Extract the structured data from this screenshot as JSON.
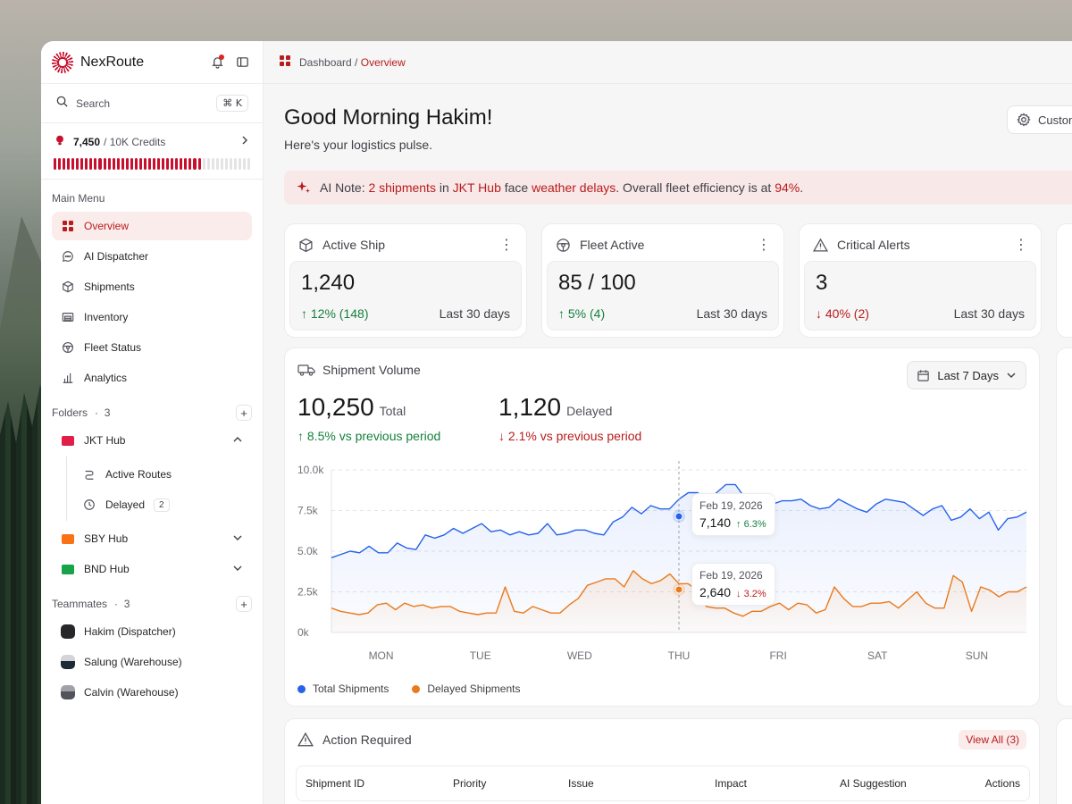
{
  "app": {
    "name": "NexRoute"
  },
  "search": {
    "label": "Search",
    "shortcut": "⌘ K"
  },
  "credits": {
    "used": "7,450",
    "total": "/ 10K Credits",
    "fraction": 0.745
  },
  "menu": {
    "title": "Main Menu",
    "items": [
      {
        "label": "Overview",
        "icon": "grid-icon"
      },
      {
        "label": "AI Dispatcher",
        "icon": "chat-icon"
      },
      {
        "label": "Shipments",
        "icon": "box-icon"
      },
      {
        "label": "Inventory",
        "icon": "warehouse-icon"
      },
      {
        "label": "Fleet Status",
        "icon": "steering-wheel-icon"
      },
      {
        "label": "Analytics",
        "icon": "bar-chart-icon"
      }
    ]
  },
  "folders": {
    "title": "Folders",
    "count": "3",
    "items": [
      {
        "label": "JKT Hub",
        "color": "#e11d48",
        "sub": [
          {
            "label": "Active Routes"
          },
          {
            "label": "Delayed",
            "badge": "2"
          }
        ]
      },
      {
        "label": "SBY Hub",
        "color": "#f97316"
      },
      {
        "label": "BND Hub",
        "color": "#16a34a"
      }
    ]
  },
  "teammates": {
    "title": "Teammates",
    "count": "3",
    "items": [
      {
        "label": "Hakim (Dispatcher)"
      },
      {
        "label": "Salung (Warehouse)"
      },
      {
        "label": "Calvin (Warehouse)"
      }
    ]
  },
  "breadcrumb": {
    "root": "Dashboard",
    "sep": " / ",
    "current": "Overview"
  },
  "header": {
    "greeting": "Good Morning Hakim!",
    "subtitle": "Here's your logistics pulse.",
    "customize": "Custom"
  },
  "ai_note": {
    "prefix": "AI Note: ",
    "count": "2 shipments",
    "in": " in ",
    "hub": "JKT Hub",
    "face": " face ",
    "issue": "weather delays",
    "mid": ". Overall fleet efficiency is at ",
    "efficiency": "94%",
    "end": "."
  },
  "stats": [
    {
      "label": "Active Ship",
      "value": "1,240",
      "delta": "↑ 12% (148)",
      "trend": "up",
      "period": "Last 30 days"
    },
    {
      "label": "Fleet Active",
      "value": "85 / 100",
      "delta": "↑ 5% (4)",
      "trend": "up",
      "period": "Last 30 days"
    },
    {
      "label": "Critical Alerts",
      "value": "3",
      "delta": "↓ 40% (2)",
      "trend": "down",
      "period": "Last 30 days"
    }
  ],
  "volume": {
    "title": "Shipment Volume",
    "range": "Last 7 Days",
    "total_value": "10,250",
    "total_label": "Total",
    "total_change": "↑ 8.5% vs previous period",
    "delayed_value": "1,120",
    "delayed_label": "Delayed",
    "delayed_change": "↓ 2.1% vs previous period",
    "tooltip_total": {
      "date": "Feb 19, 2026",
      "value": "7,140",
      "change": "↑ 6.3%"
    },
    "tooltip_delayed": {
      "date": "Feb 19, 2026",
      "value": "2,640",
      "change": "↓ 3.2%"
    }
  },
  "chart_data": {
    "type": "area",
    "yticks": [
      "10.0k",
      "7.5k",
      "5.0k",
      "2.5k",
      "0k"
    ],
    "ylim": [
      0,
      10000
    ],
    "categories": [
      "MON",
      "TUE",
      "WED",
      "THU",
      "FRI",
      "SAT",
      "SUN"
    ],
    "series": [
      {
        "name": "Total Shipments",
        "color": "#2563eb",
        "values": [
          4600,
          4800,
          5000,
          4900,
          5300,
          4900,
          4900,
          5500,
          5200,
          5100,
          6000,
          5800,
          6000,
          6400,
          6100,
          6400,
          6700,
          6200,
          6300,
          6000,
          6200,
          6000,
          6100,
          6700,
          6000,
          6100,
          6300,
          6300,
          6100,
          6000,
          6800,
          7100,
          7700,
          7300,
          7800,
          7600,
          7600,
          8200,
          8600,
          8600,
          8100,
          8600,
          9100,
          9100,
          8300,
          8500,
          7800,
          7900,
          8100,
          8100,
          8200,
          7800,
          7600,
          7700,
          8200,
          7900,
          7600,
          7400,
          7900,
          8200,
          8100,
          8000,
          7600,
          7200,
          7600,
          7800,
          6900,
          7100,
          7600,
          7000,
          7400,
          6300,
          7000,
          7100,
          7400
        ]
      },
      {
        "name": "Delayed Shipments",
        "color": "#ea7a1c",
        "values": [
          1500,
          1300,
          1200,
          1100,
          1200,
          1700,
          1800,
          1400,
          1800,
          1600,
          1700,
          1500,
          1600,
          1600,
          1300,
          1200,
          1100,
          1200,
          1200,
          2800,
          1300,
          1200,
          1600,
          1400,
          1200,
          1200,
          1700,
          2100,
          2900,
          3100,
          3300,
          3300,
          2800,
          3800,
          3300,
          3000,
          3200,
          3600,
          3000,
          3000,
          2600,
          1600,
          1500,
          1500,
          1200,
          1000,
          1300,
          1300,
          1600,
          1800,
          1400,
          1800,
          1700,
          1200,
          1400,
          2800,
          2100,
          1600,
          1600,
          1800,
          1800,
          1900,
          1500,
          2000,
          2500,
          1800,
          1500,
          1500,
          3500,
          3100,
          1300,
          2800,
          2600,
          2200,
          2500,
          2500,
          2800
        ]
      }
    ],
    "highlight": {
      "category": "THU",
      "total": 7140,
      "delayed": 2640
    }
  },
  "legend": {
    "total": "Total Shipments",
    "delayed": "Delayed Shipments"
  },
  "actions": {
    "title": "Action Required",
    "view_all": "View All (3)",
    "columns": [
      "Shipment ID",
      "Priority",
      "Issue",
      "Impact",
      "AI Suggestion",
      "Actions"
    ]
  }
}
